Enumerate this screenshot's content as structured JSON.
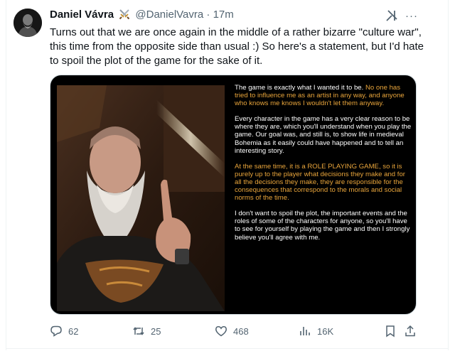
{
  "tweet": {
    "author_name": "Daniel Vávra",
    "handle": "@DanielVavra",
    "separator": "·",
    "time": "17m",
    "text": "Turns out that we are once again in the middle of a rather bizarre \"culture war\", this time from the opposite side than usual :) So here's a statement, but I'd hate to spoil the plot of the game for the sake of it."
  },
  "statement": {
    "p1_white": "The game is exactly what I wanted it to be.",
    "p1_orange": "No one has tried to influence me as an artist in any way, and anyone who knows me knows I wouldn't let them anyway.",
    "p2": "Every character in the game has a very clear reason to be where they are, which you'll understand when you play the game. Our goal was, and still is, to show life in medieval Bohemia as it easily could have happened and to tell an interesting story.",
    "p3": "At the same time, it is a ROLE PLAYING GAME, so it is purely up to the player what decisions they make and for all the decisions they make, they are responsible for the consequences that correspond to the morals and social norms of the time.",
    "p4": "I don't want to spoil the plot, the important events and the roles of some of the characters for anyone, so you'll have to see for yourself by playing the game and then I strongly believe you'll agree with me."
  },
  "actions": {
    "replies": "62",
    "reposts": "25",
    "likes": "468",
    "views": "16K"
  },
  "icons": [
    "avatar",
    "crossed-swords-icon",
    "grok-icon",
    "more-icon",
    "reply-icon",
    "repost-icon",
    "like-icon",
    "views-icon",
    "bookmark-icon",
    "share-icon"
  ],
  "colors": {
    "statement_highlight": "#e9a53b",
    "secondary_text": "#536471",
    "primary_text": "#0f1419"
  }
}
